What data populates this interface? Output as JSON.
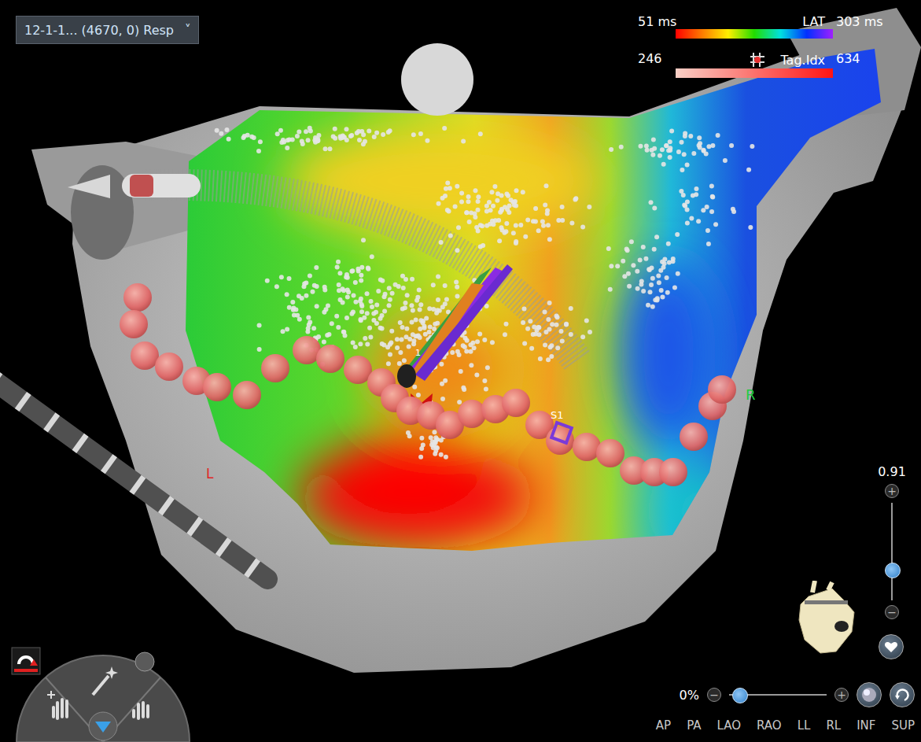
{
  "dataset": {
    "label": "12-1-1... (4670, 0) Resp",
    "chevron": "˅"
  },
  "legends": [
    {
      "name": "LAT",
      "min": "51 ms",
      "max": "303 ms",
      "kind": "rainbow"
    },
    {
      "name": "Tag.Idx",
      "min": "246",
      "max": "634",
      "kind": "tag"
    }
  ],
  "map_labels": [
    {
      "text": "L",
      "color": "#e02424"
    },
    {
      "text": "R",
      "color": "#22cc44"
    },
    {
      "text": "S1",
      "color": "#ffffff"
    },
    {
      "text": "1",
      "color": "#ffffff"
    }
  ],
  "zoom": {
    "value": "0.91",
    "level": 0.3,
    "plus": "+",
    "minus": "−"
  },
  "transparency": {
    "value": "0%",
    "level": 0,
    "plus": "+",
    "minus": "−"
  },
  "views": [
    {
      "label": "AP",
      "selected": false
    },
    {
      "label": "PA",
      "selected": false
    },
    {
      "label": "LAO",
      "selected": false
    },
    {
      "label": "RAO",
      "selected": false
    },
    {
      "label": "LL",
      "selected": false
    },
    {
      "label": "RL",
      "selected": false
    },
    {
      "label": "INF",
      "selected": false
    },
    {
      "label": "SUP",
      "selected": false
    }
  ]
}
